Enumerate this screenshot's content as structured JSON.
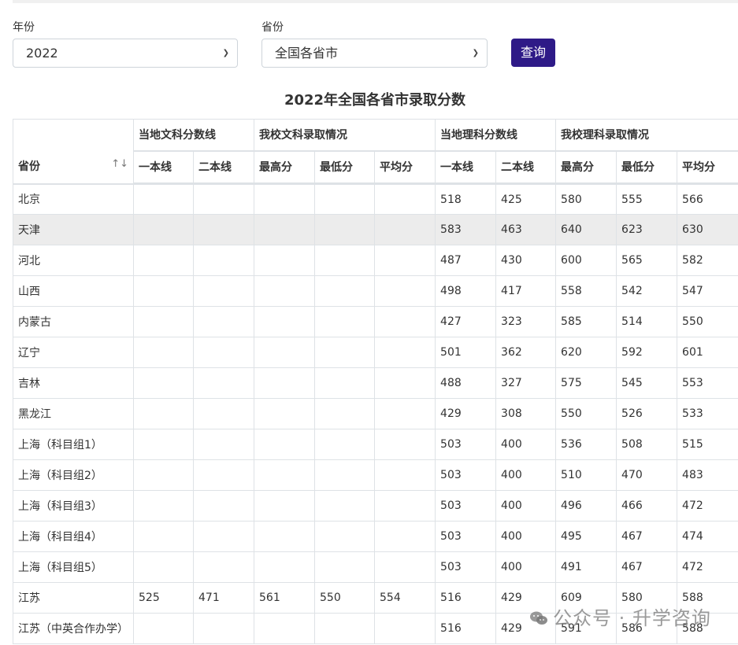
{
  "filters": {
    "year_label": "年份",
    "year_value": "2022",
    "province_label": "省份",
    "province_value": "全国各省市",
    "query_button": "查询"
  },
  "title": "2022年全国各省市录取分数",
  "table": {
    "province_header": "省份",
    "groups": [
      "当地文科分数线",
      "我校文科录取情况",
      "当地理科分数线",
      "我校理科录取情况"
    ],
    "subheaders": [
      "一本线",
      "二本线",
      "最高分",
      "最低分",
      "平均分",
      "一本线",
      "二本线",
      "最高分",
      "最低分",
      "平均分"
    ],
    "rows": [
      {
        "province": "北京",
        "values": [
          "",
          "",
          "",
          "",
          "",
          "518",
          "425",
          "580",
          "555",
          "566"
        ]
      },
      {
        "province": "天津",
        "values": [
          "",
          "",
          "",
          "",
          "",
          "583",
          "463",
          "640",
          "623",
          "630"
        ]
      },
      {
        "province": "河北",
        "values": [
          "",
          "",
          "",
          "",
          "",
          "487",
          "430",
          "600",
          "565",
          "582"
        ]
      },
      {
        "province": "山西",
        "values": [
          "",
          "",
          "",
          "",
          "",
          "498",
          "417",
          "558",
          "542",
          "547"
        ]
      },
      {
        "province": "内蒙古",
        "values": [
          "",
          "",
          "",
          "",
          "",
          "427",
          "323",
          "585",
          "514",
          "550"
        ]
      },
      {
        "province": "辽宁",
        "values": [
          "",
          "",
          "",
          "",
          "",
          "501",
          "362",
          "620",
          "592",
          "601"
        ]
      },
      {
        "province": "吉林",
        "values": [
          "",
          "",
          "",
          "",
          "",
          "488",
          "327",
          "575",
          "545",
          "553"
        ]
      },
      {
        "province": "黑龙江",
        "values": [
          "",
          "",
          "",
          "",
          "",
          "429",
          "308",
          "550",
          "526",
          "533"
        ]
      },
      {
        "province": "上海（科目组1）",
        "values": [
          "",
          "",
          "",
          "",
          "",
          "503",
          "400",
          "536",
          "508",
          "515"
        ]
      },
      {
        "province": "上海（科目组2）",
        "values": [
          "",
          "",
          "",
          "",
          "",
          "503",
          "400",
          "510",
          "470",
          "483"
        ]
      },
      {
        "province": "上海（科目组3）",
        "values": [
          "",
          "",
          "",
          "",
          "",
          "503",
          "400",
          "496",
          "466",
          "472"
        ]
      },
      {
        "province": "上海（科目组4）",
        "values": [
          "",
          "",
          "",
          "",
          "",
          "503",
          "400",
          "495",
          "467",
          "474"
        ]
      },
      {
        "province": "上海（科目组5）",
        "values": [
          "",
          "",
          "",
          "",
          "",
          "503",
          "400",
          "491",
          "467",
          "472"
        ]
      },
      {
        "province": "江苏",
        "values": [
          "525",
          "471",
          "561",
          "550",
          "554",
          "516",
          "429",
          "609",
          "580",
          "588"
        ]
      },
      {
        "province": "江苏（中英合作办学）",
        "values": [
          "",
          "",
          "",
          "",
          "",
          "516",
          "429",
          "591",
          "586",
          "588"
        ]
      }
    ]
  },
  "watermark": "公众号 · 升学咨询",
  "icons": {
    "sort": "sort-arrows-icon",
    "chevron": "chevron-down-icon",
    "wechat": "wechat-icon"
  }
}
